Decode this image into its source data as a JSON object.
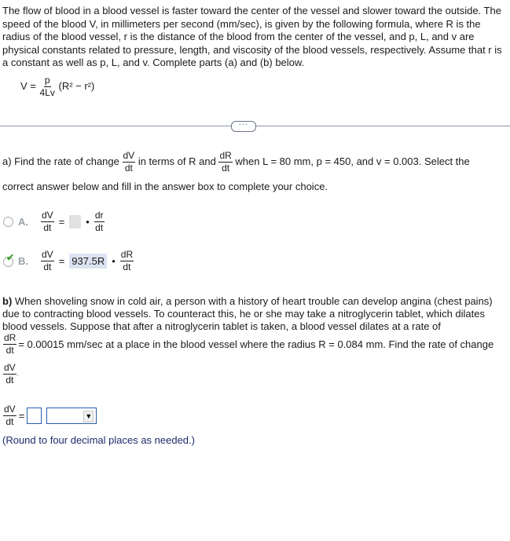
{
  "intro": {
    "text": "The flow of blood in a blood vessel is faster toward the center of the vessel and slower toward the outside. The speed of the blood V, in millimeters per second (mm/sec), is given by the following formula, where R is the radius of the blood vessel, r is the distance of the blood from the center of the vessel, and p, L, and v are physical constants related to pressure, length, and viscosity of the blood vessels, respectively. Assume that r is a constant as well as p, L, and v. Complete parts (a) and (b) below."
  },
  "formula": {
    "lhs": "V =",
    "num": "p",
    "den": "4Lv",
    "paren": "(R² − r²)"
  },
  "divider": {
    "more_label": "···"
  },
  "part_a": {
    "prefix": "a) Find the rate of change",
    "frac1_num": "dV",
    "frac1_den": "dt",
    "mid": "in terms of R and",
    "frac2_num": "dR",
    "frac2_den": "dt",
    "suffix": "when L = 80 mm, p = 450, and v = 0.003. Select the",
    "line2": "correct answer below and fill in the answer box to complete your choice.",
    "choices": [
      {
        "letter": "A.",
        "lhs_num": "dV",
        "lhs_den": "dt",
        "eq": "=",
        "value": "",
        "dot": "•",
        "rhs_num": "dr",
        "rhs_den": "dt",
        "selected": false
      },
      {
        "letter": "B.",
        "lhs_num": "dV",
        "lhs_den": "dt",
        "eq": "=",
        "value": "937.5R",
        "dot": "•",
        "rhs_num": "dR",
        "rhs_den": "dt",
        "selected": true,
        "check": "✔"
      }
    ]
  },
  "part_b": {
    "label": "b)",
    "line1": " When shoveling snow in cold air, a person with a history of heart trouble can develop angina (chest pains)",
    "line2": "due to contracting blood vessels. To counteract this, he or she may take a nitroglycerin tablet, which dilates",
    "line3": "blood vessels. Suppose that after a nitroglycerin tablet is taken, a blood vessel dilates at a rate of",
    "rate_num": "dR",
    "rate_den": "dt",
    "rate_text": "= 0.00015 mm/sec at a place in the blood vessel where the radius R = 0.084 mm. Find the rate of change",
    "find_num": "dV",
    "find_den": "dt",
    "find_end": ".",
    "answer_num": "dV",
    "answer_den": "dt",
    "answer_eq": "=",
    "answer_value": "",
    "unit_select_value": "",
    "select_arrow": "▼",
    "note": "(Round to four decimal places as needed.)"
  }
}
